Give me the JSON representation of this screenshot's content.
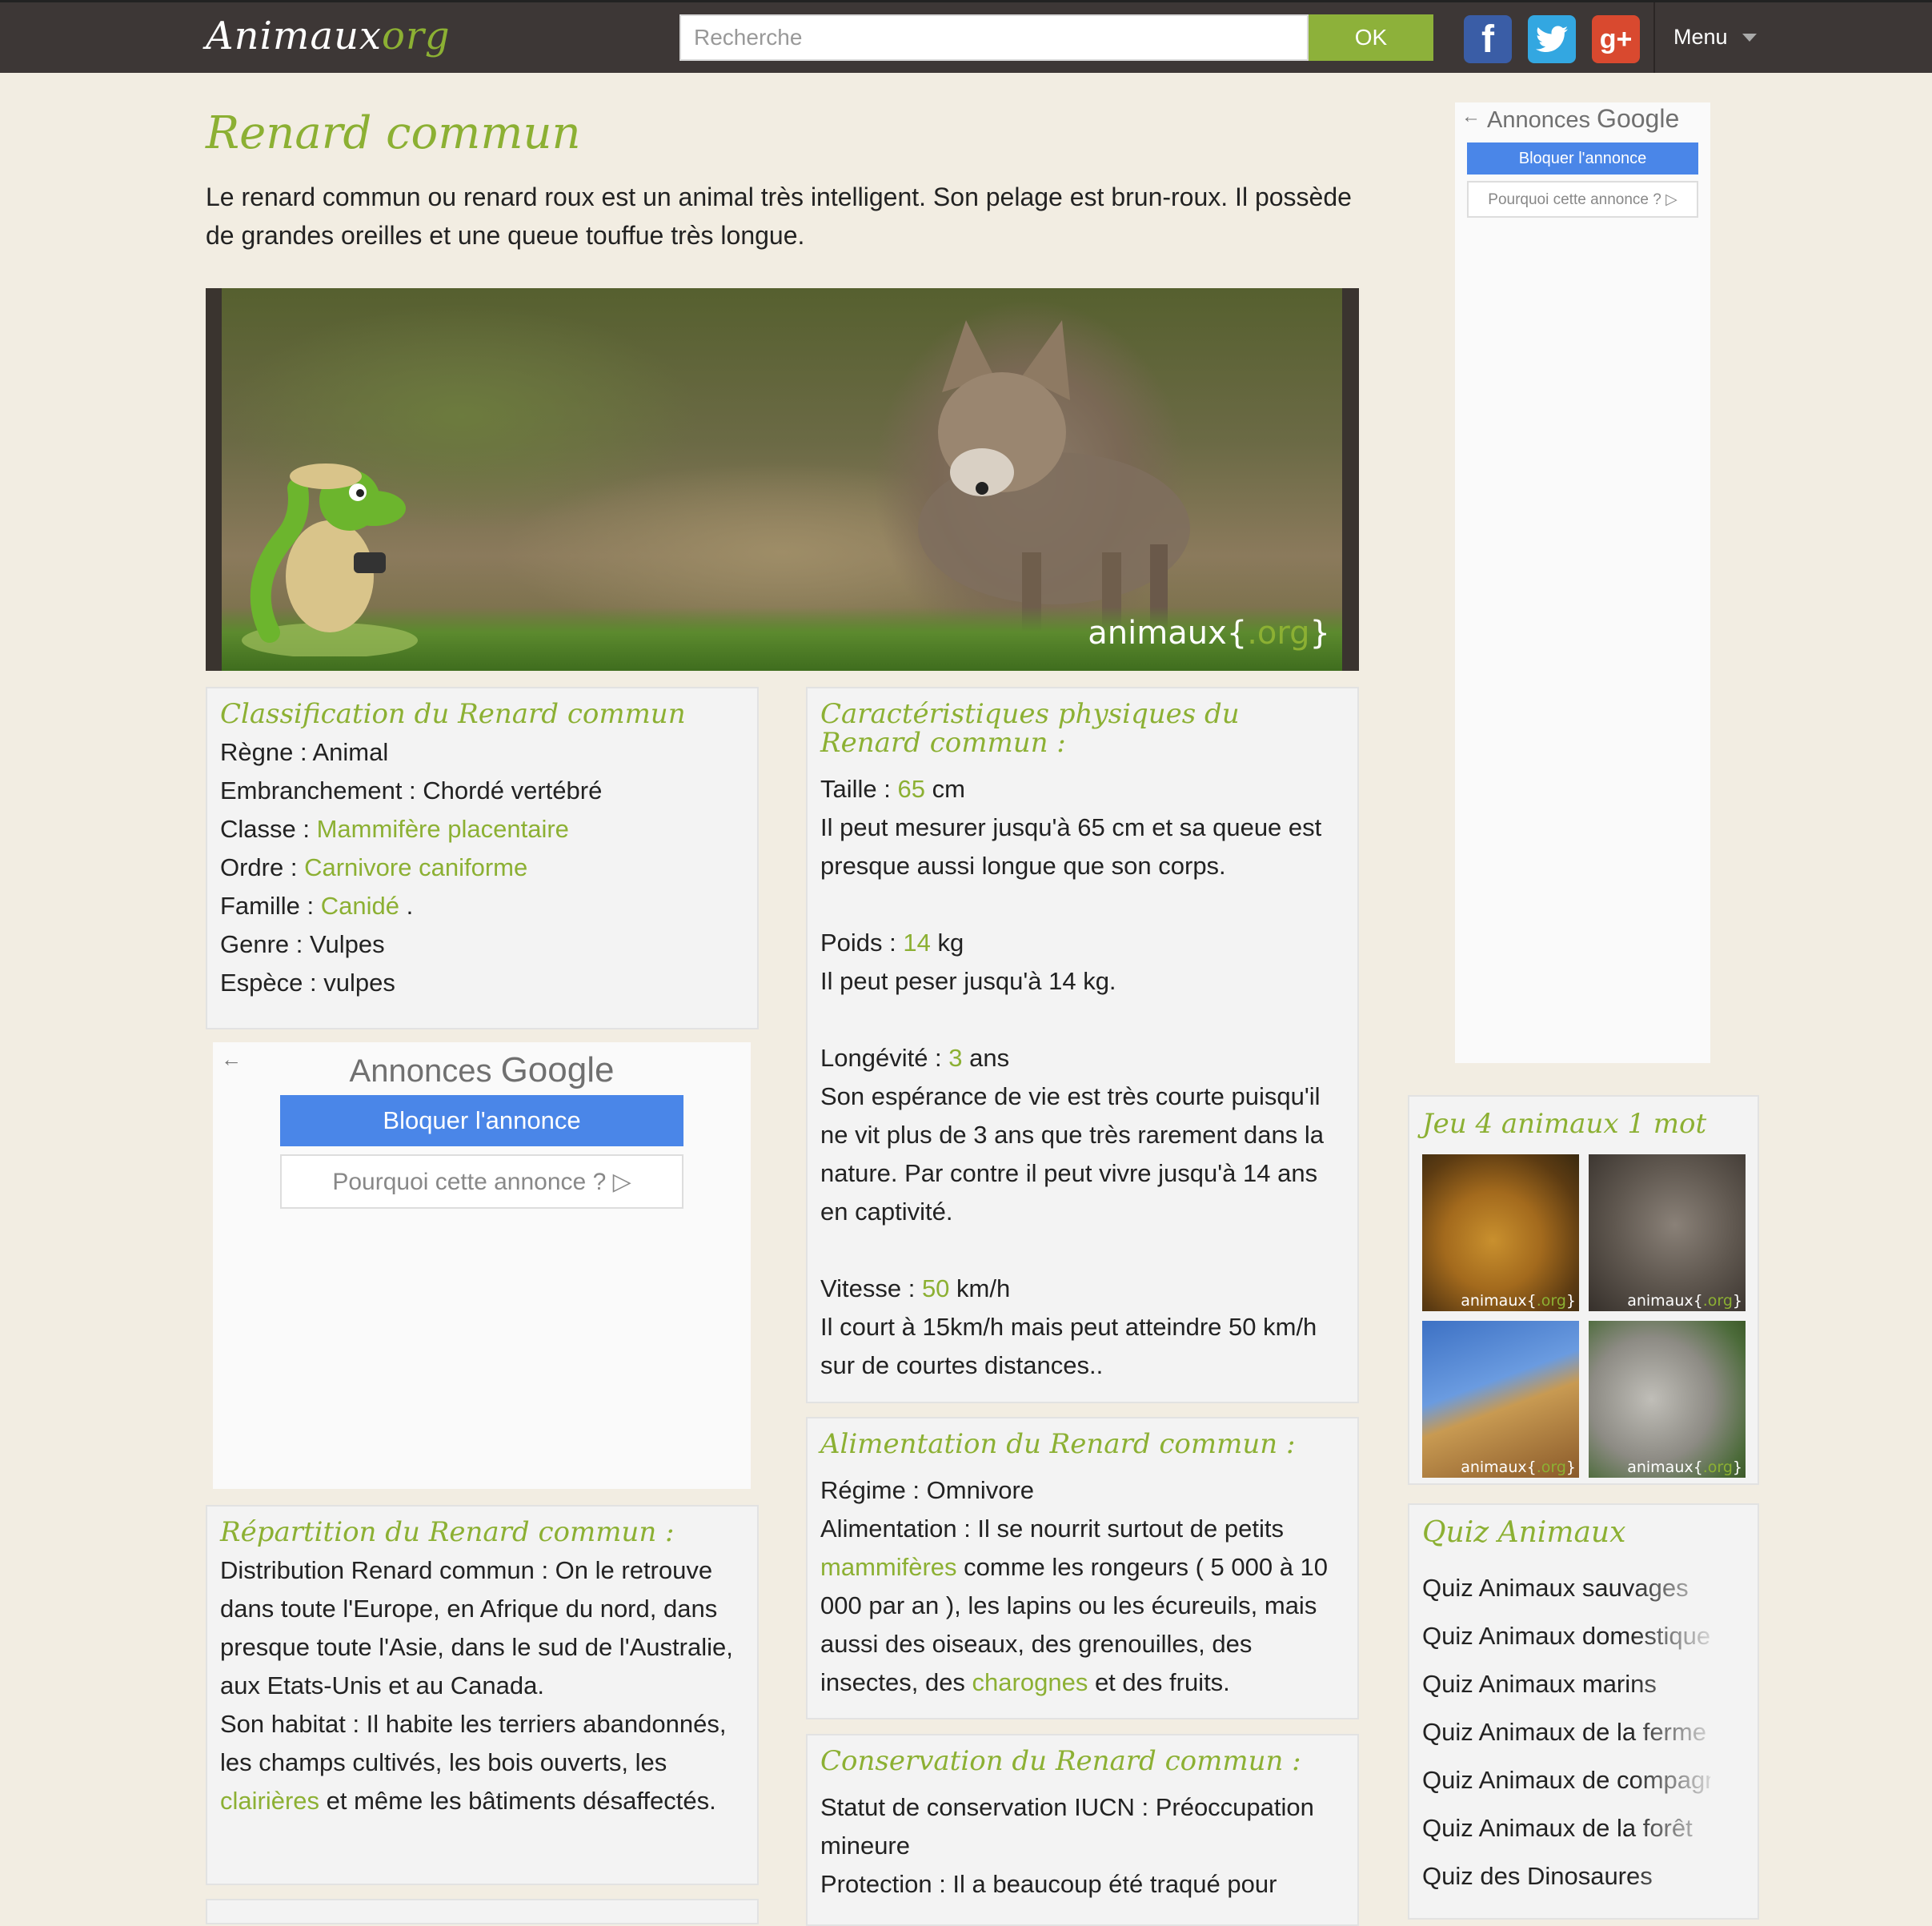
{
  "header": {
    "logo_main": "Animaux",
    "logo_suffix": "org",
    "search_placeholder": "Recherche",
    "search_button": "OK",
    "social": {
      "facebook": "f",
      "twitter": "",
      "google_plus": "g+"
    },
    "menu_label": "Menu",
    "icons": {
      "menu": "chevron-down-icon"
    }
  },
  "colors": {
    "accent": "#8cb033",
    "topbar": "#3d3736",
    "background": "#f2ede2",
    "ad_button": "#4a86e8"
  },
  "page": {
    "title": "Renard commun",
    "intro": "Le renard commun ou renard roux est un animal très intelligent. Son pelage est brun-roux. Il possède de grandes oreilles et une queue touffue très longue.",
    "hero_watermark_main": "animaux{",
    "hero_watermark_org": ".org",
    "hero_watermark_end": "}"
  },
  "classification": {
    "title": "Classification du Renard commun",
    "regne_label": "Règne : ",
    "regne": "Animal",
    "embranchement_label": "Embranchement : ",
    "embranchement": "Chordé vertébré",
    "classe_label": "Classe : ",
    "classe": "Mammifère placentaire",
    "ordre_label": "Ordre : ",
    "ordre": "Carnivore caniforme",
    "famille_label": "Famille : ",
    "famille": "Canidé",
    "famille_suffix": " .",
    "genre_label": "Genre : ",
    "genre": "Vulpes",
    "espece_label": "Espèce : ",
    "espece": "vulpes"
  },
  "ad_main": {
    "brand_prefix": "Annonces ",
    "brand_google": "Google",
    "block_label": "Bloquer l'annonce",
    "why_label": "Pourquoi cette annonce ? ▷"
  },
  "ad_side": {
    "brand_prefix": "Annonces ",
    "brand_google": "Google",
    "block_label": "Bloquer l'annonce",
    "why_label": "Pourquoi cette annonce ? ▷"
  },
  "repartition": {
    "title": "Répartition du Renard commun :",
    "distribution": "Distribution Renard commun : On le retrouve dans toute l'Europe, en Afrique du nord, dans presque toute l'Asie, dans le sud de l'Australie, aux Etats-Unis et au Canada.",
    "habitat_before": "Son habitat : Il habite les terriers abandonnés, les champs cultivés, les bois ouverts, les ",
    "habitat_link": "clairières",
    "habitat_after": " et même les bâtiments désaffectés."
  },
  "physical": {
    "title": "Caractéristiques physiques du Renard commun :",
    "taille_label": "Taille : ",
    "taille_value": "65",
    "taille_unit": " cm",
    "taille_desc": "Il peut mesurer jusqu'à 65 cm et sa queue est presque aussi longue que son corps.",
    "poids_label": "Poids : ",
    "poids_value": "14",
    "poids_unit": " kg",
    "poids_desc": "Il peut peser jusqu'à 14 kg.",
    "longevite_label": "Longévité : ",
    "longevite_value": "3",
    "longevite_unit": " ans",
    "longevite_desc": "Son espérance de vie est très courte puisqu'il ne vit plus de 3 ans que très rarement dans la nature. Par contre il peut vivre jusqu'à 14 ans en captivité.",
    "vitesse_label": "Vitesse : ",
    "vitesse_value": "50",
    "vitesse_unit": " km/h",
    "vitesse_desc": "Il court à 15km/h mais peut atteindre 50 km/h sur de courtes distances.."
  },
  "feeding": {
    "title": "Alimentation du Renard commun :",
    "regime": "Régime : Omnivore",
    "alim_before": "Alimentation : Il se nourrit surtout de petits ",
    "alim_link1": "mammifères",
    "alim_middle": " comme les rongeurs ( 5 000 à 10 000 par an ), les lapins ou les écureuils, mais aussi des oiseaux, des grenouilles, des insectes, des ",
    "alim_link2": "charognes",
    "alim_after": " et des fruits."
  },
  "conservation": {
    "title": "Conservation du Renard commun :",
    "statut": "Statut de conservation IUCN : Préoccupation mineure",
    "protection": "Protection : Il a beaucoup été traqué pour"
  },
  "game": {
    "title": "Jeu 4 animaux 1 mot",
    "thumbs": [
      "lion-photo",
      "elephant-photo",
      "giraffe-photo",
      "rhino-photo"
    ],
    "watermark_main": "animaux{",
    "watermark_org": ".org",
    "watermark_end": "}"
  },
  "quiz": {
    "title": "Quiz Animaux",
    "items": [
      "Quiz Animaux sauvages",
      "Quiz Animaux domestiques",
      "Quiz Animaux marins",
      "Quiz Animaux de la ferme",
      "Quiz Animaux de compagnie",
      "Quiz Animaux de la forêt",
      "Quiz des Dinosaures"
    ]
  }
}
